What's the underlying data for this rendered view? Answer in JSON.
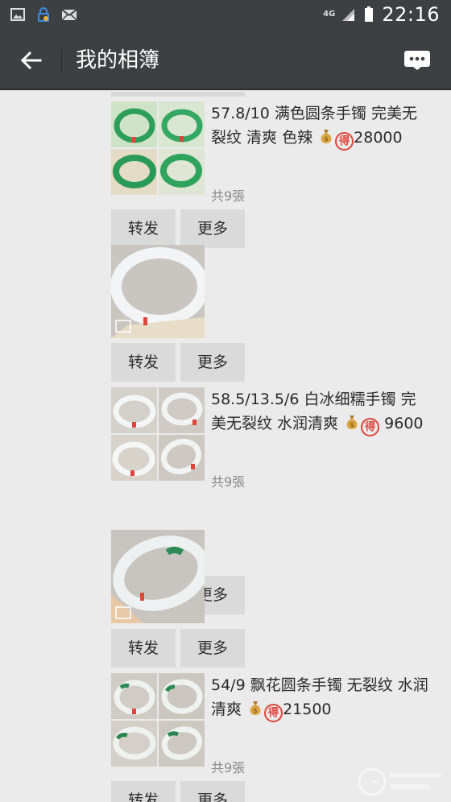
{
  "status_bar": {
    "network": "4G",
    "time": "22:16",
    "icons": [
      "gallery-icon",
      "vpn-lock-icon",
      "mail-icon",
      "signal-icon",
      "battery-icon"
    ]
  },
  "nav": {
    "title": "我的相簿",
    "back_icon": "arrow-left-icon",
    "more_icon": "more-dots-icon"
  },
  "posts": [
    {
      "caption": "57.8/10 满色圆条手镯 完美无裂纹 清爽 色辣",
      "price": "28000",
      "count": "共9張",
      "images": "grid",
      "forward": "转发",
      "more": "更多"
    },
    {
      "caption": "",
      "price": "",
      "count": "",
      "images": "single",
      "forward": "转发",
      "more": "更多"
    },
    {
      "caption": "58.5/13.5/6  白冰细糯手镯 完美无裂纹  水润清爽",
      "price": "9600",
      "count": "共9張",
      "images": "grid",
      "forward": "转发",
      "more": "更多"
    },
    {
      "caption": "",
      "price": "",
      "count": "",
      "images": "single",
      "forward": "转发",
      "more": "更多"
    },
    {
      "caption": "54/9 飘花圆条手镯  无裂纹 水润清爽",
      "price": "21500",
      "count": "共9張",
      "images": "grid",
      "forward": "转发",
      "more": "更多"
    }
  ],
  "emoji": {
    "money_bag": "money-bag-icon",
    "de_char": "得"
  },
  "colors": {
    "bar": "#3d4043",
    "background": "#ebebeb",
    "button": "#dadada",
    "jade_green": "#2e9e5b",
    "red_tag": "#e0453b"
  }
}
